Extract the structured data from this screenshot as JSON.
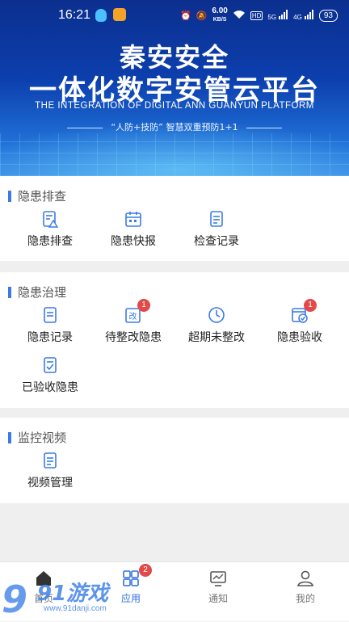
{
  "status": {
    "time": "16:21",
    "speed": "6.00",
    "speed_unit": "KB/S",
    "hd": "HD",
    "net1": "5G",
    "net2": "4G",
    "battery": "93"
  },
  "banner": {
    "title1": "秦安安全",
    "title2": "一体化数字安管云平台",
    "en": "THE INTEGRATION OF DIGITAL ANN GUANYUN PLATFORM",
    "sub": "“人防+技防” 智慧双重预防1+1"
  },
  "sections": {
    "check": {
      "title": "隐患排查",
      "items": [
        "隐患排查",
        "隐患快报",
        "检查记录"
      ]
    },
    "govern": {
      "title": "隐患治理",
      "items": [
        "隐患记录",
        "待整改隐患",
        "超期未整改",
        "隐患验收",
        "已验收隐患"
      ],
      "badges": {
        "pending": "1",
        "accept": "1"
      }
    },
    "monitor": {
      "title": "监控视频",
      "items": [
        "视频管理"
      ]
    }
  },
  "tabbar": {
    "items": [
      "首页",
      "应用",
      "通知",
      "我的"
    ],
    "app_badge": "2",
    "active_color": "#2f6fe0"
  },
  "watermark": {
    "text": "91游戏",
    "url": "www.91danji.com"
  }
}
